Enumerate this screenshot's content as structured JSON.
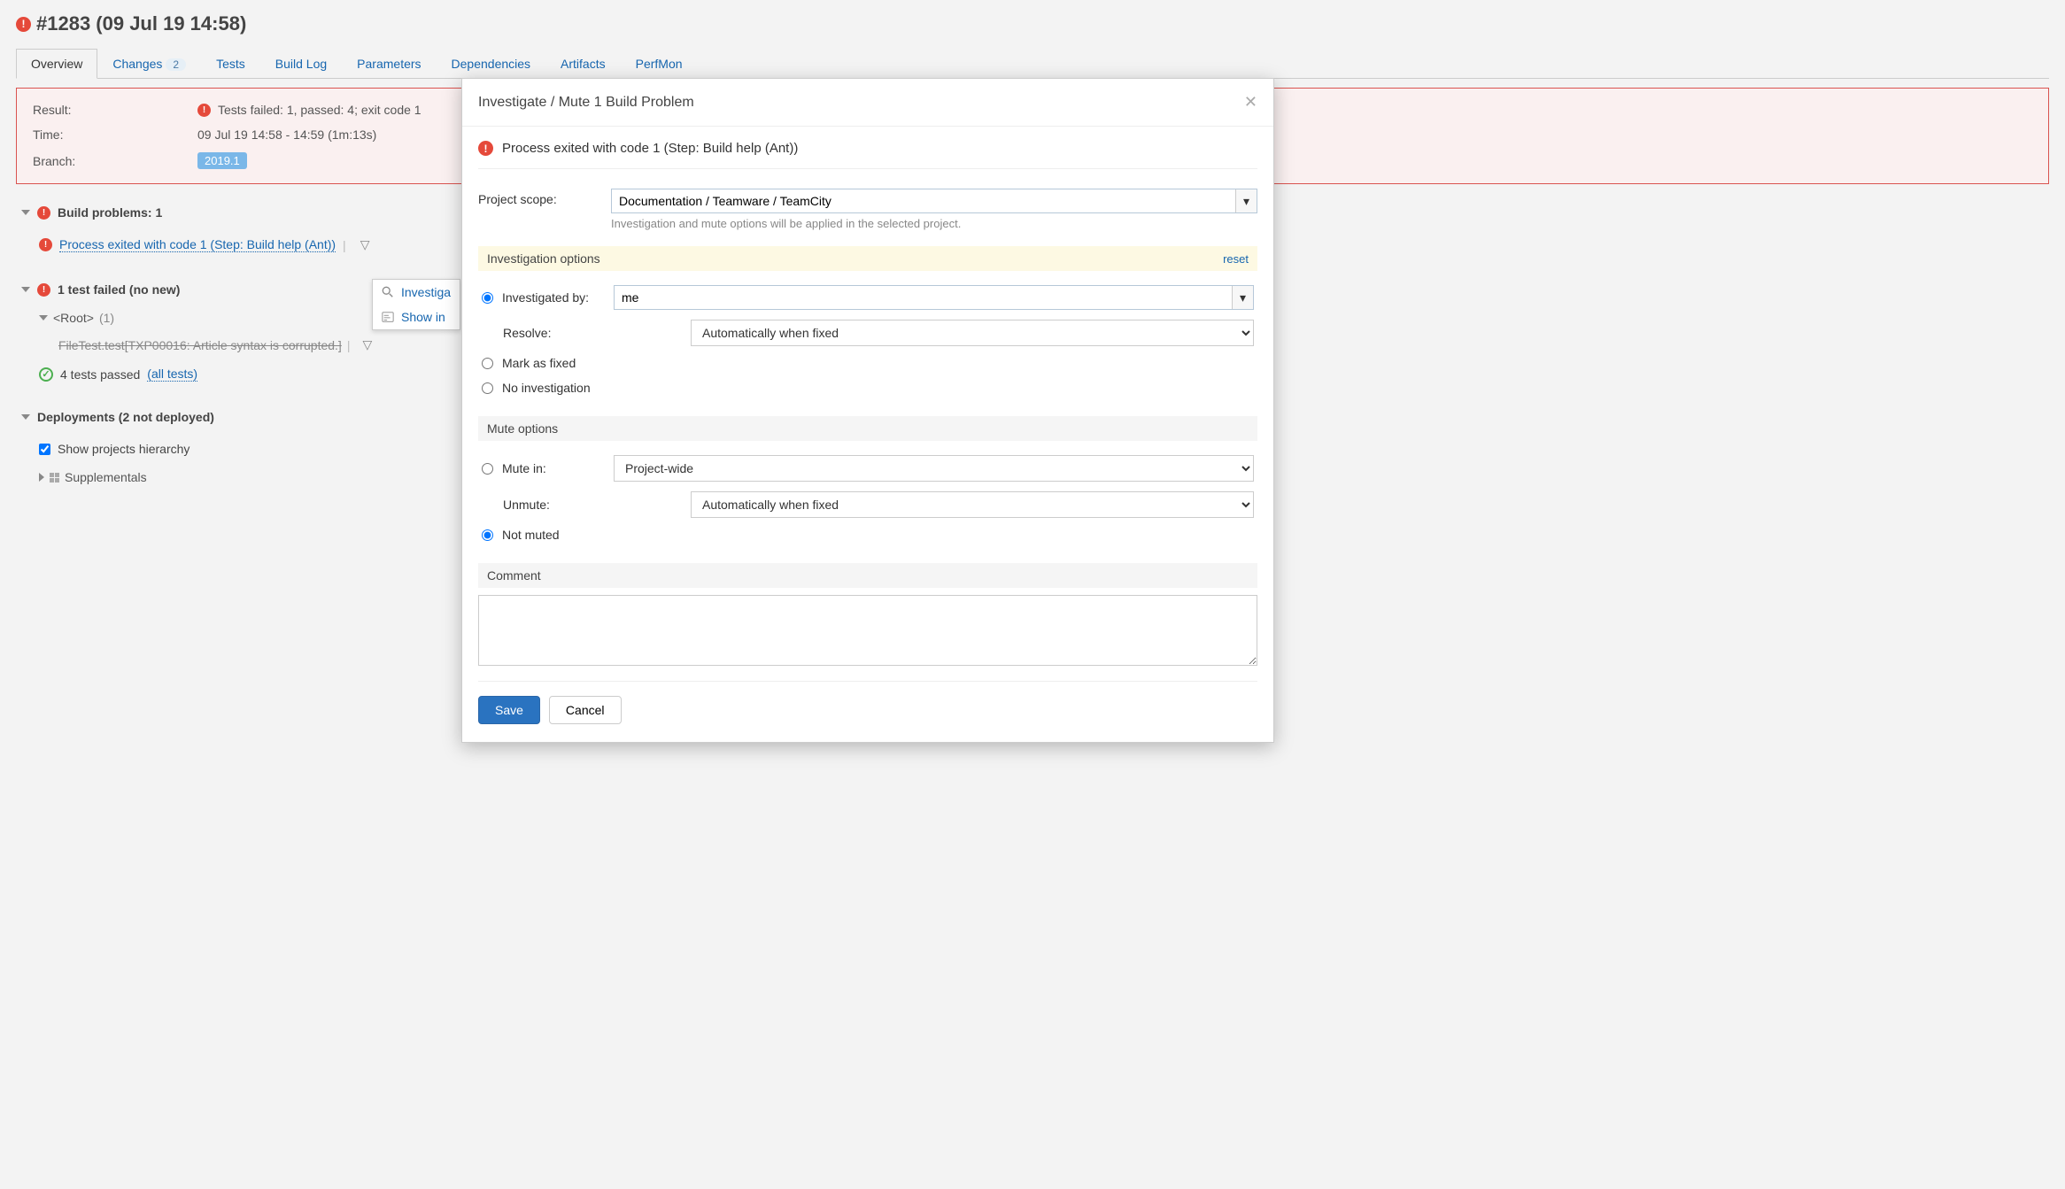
{
  "build": {
    "title": "#1283 (09 Jul 19 14:58)",
    "result_label": "Result:",
    "result_value": "Tests failed: 1, passed: 4; exit code 1",
    "time_label": "Time:",
    "time_value": "09 Jul 19 14:58 - 14:59 (1m:13s)",
    "branch_label": "Branch:",
    "branch_value": "2019.1"
  },
  "tabs": {
    "overview": "Overview",
    "changes": "Changes",
    "changes_count": "2",
    "tests": "Tests",
    "build_log": "Build Log",
    "parameters": "Parameters",
    "dependencies": "Dependencies",
    "artifacts": "Artifacts",
    "perfmon": "PerfMon"
  },
  "sections": {
    "build_problems": "Build problems: 1",
    "problem_link": "Process exited with code 1 (Step: Build help (Ant))",
    "test_failed": "1 test failed (no new)",
    "root_label": "<Root>",
    "root_count": "(1)",
    "failed_test": "FileTest.test[TXP00016: Article syntax is corrupted.]",
    "passed_text": "4 tests passed",
    "all_tests": "(all tests)",
    "deployments": "Deployments (2 not deployed)",
    "show_hierarchy": "Show projects hierarchy",
    "supplementals": "Supplementals"
  },
  "popup": {
    "investigate": "Investiga",
    "show_in": "Show in"
  },
  "dialog": {
    "title": "Investigate / Mute 1 Build Problem",
    "problem": "Process exited with code 1 (Step: Build help (Ant))",
    "scope_label": "Project scope:",
    "scope_value": "Documentation / Teamware / TeamCity",
    "scope_hint": "Investigation and mute options will be applied in the selected project.",
    "inv_header": "Investigation options",
    "reset": "reset",
    "investigated_by": "Investigated by:",
    "investigated_value": "me",
    "resolve_label": "Resolve:",
    "resolve_value": "Automatically when fixed",
    "mark_fixed": "Mark as fixed",
    "no_investigation": "No investigation",
    "mute_header": "Mute options",
    "mute_in_label": "Mute in:",
    "mute_in_value": "Project-wide",
    "unmute_label": "Unmute:",
    "unmute_value": "Automatically when fixed",
    "not_muted": "Not muted",
    "comment_header": "Comment",
    "save": "Save",
    "cancel": "Cancel"
  }
}
